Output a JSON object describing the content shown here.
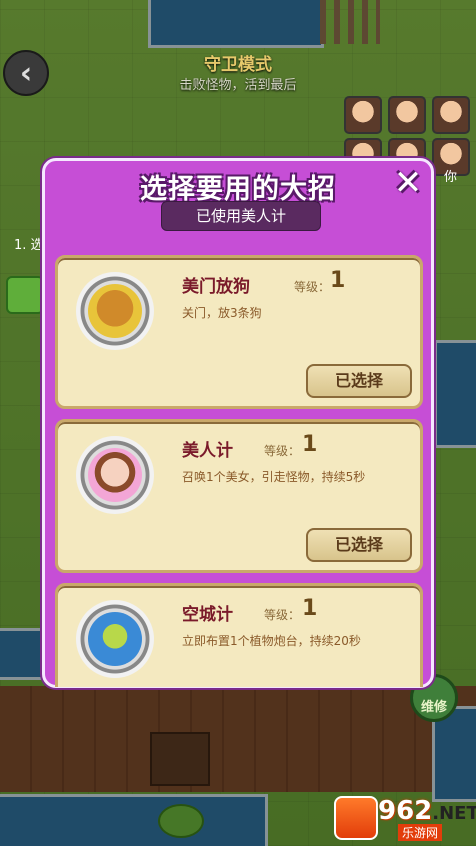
{
  "game_mode": {
    "title": "守卫模式",
    "subtitle": "击败怪物，活到最后"
  },
  "side_left": "1. 选",
  "side_right": "你",
  "repair_label": "维修",
  "logo": {
    "main": "962",
    "tld": ".NET",
    "sub": "乐游网"
  },
  "dialog": {
    "title": "选择要用的大招",
    "close_icon": "close-icon",
    "used_tag": "已使用美人计",
    "level_label": "等级：",
    "skills": [
      {
        "name": "美门放狗",
        "level": "1",
        "desc": "关门，放3条狗",
        "button": "已选择",
        "icon": "dog-icon"
      },
      {
        "name": "美人计",
        "level": "1",
        "desc": "召唤1个美女，引走怪物，持续5秒",
        "button": "已选择",
        "icon": "beauty-icon"
      },
      {
        "name": "空城计",
        "level": "1",
        "desc": "立即布置1个植物炮台，持续20秒",
        "button": "",
        "icon": "plant-turret-icon"
      }
    ]
  },
  "colors": {
    "dialog_bg": "#c64ed6",
    "card_bg": "#f4e9c0",
    "name_color": "#7a1a2a"
  }
}
